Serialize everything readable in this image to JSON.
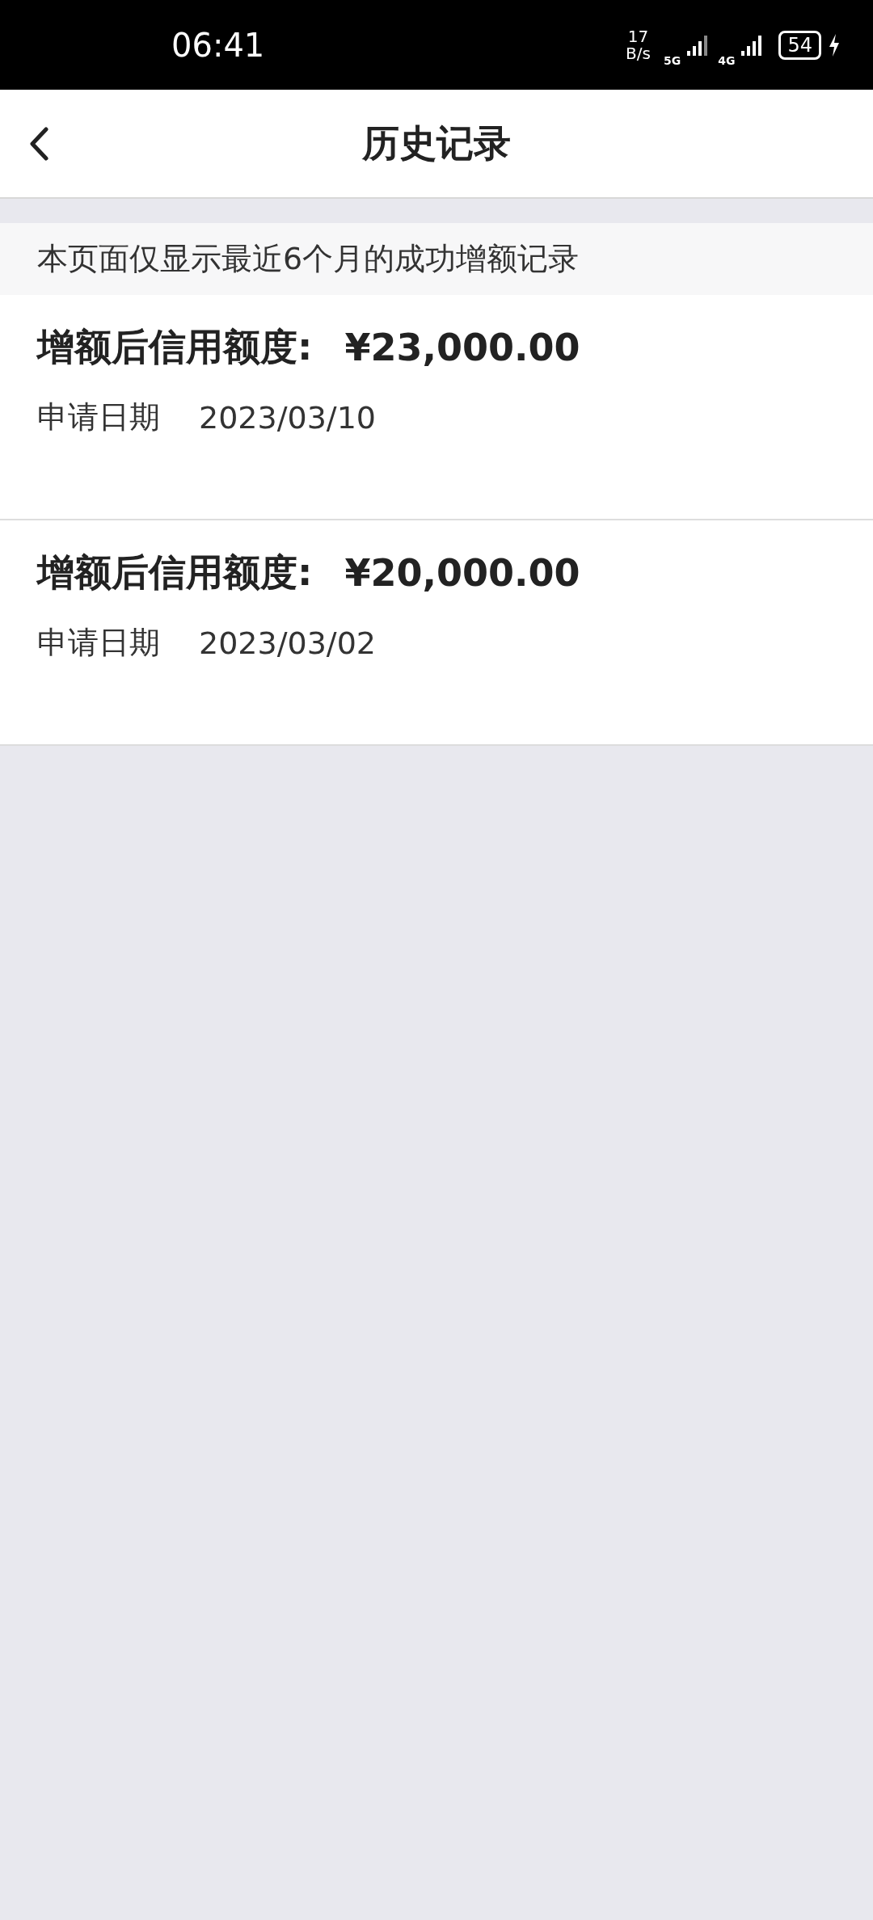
{
  "status_bar": {
    "time": "06:41",
    "net_speed_value": "17",
    "net_speed_unit": "B/s",
    "network_1": "5G",
    "network_2": "4G",
    "battery": "54"
  },
  "header": {
    "title": "历史记录"
  },
  "notice": "本页面仅显示最近6个月的成功增额记录",
  "records": [
    {
      "label": "增额后信用额度:",
      "amount": "¥23,000.00",
      "date_label": "申请日期",
      "date": "2023/03/10"
    },
    {
      "label": "增额后信用额度:",
      "amount": "¥20,000.00",
      "date_label": "申请日期",
      "date": "2023/03/02"
    }
  ]
}
